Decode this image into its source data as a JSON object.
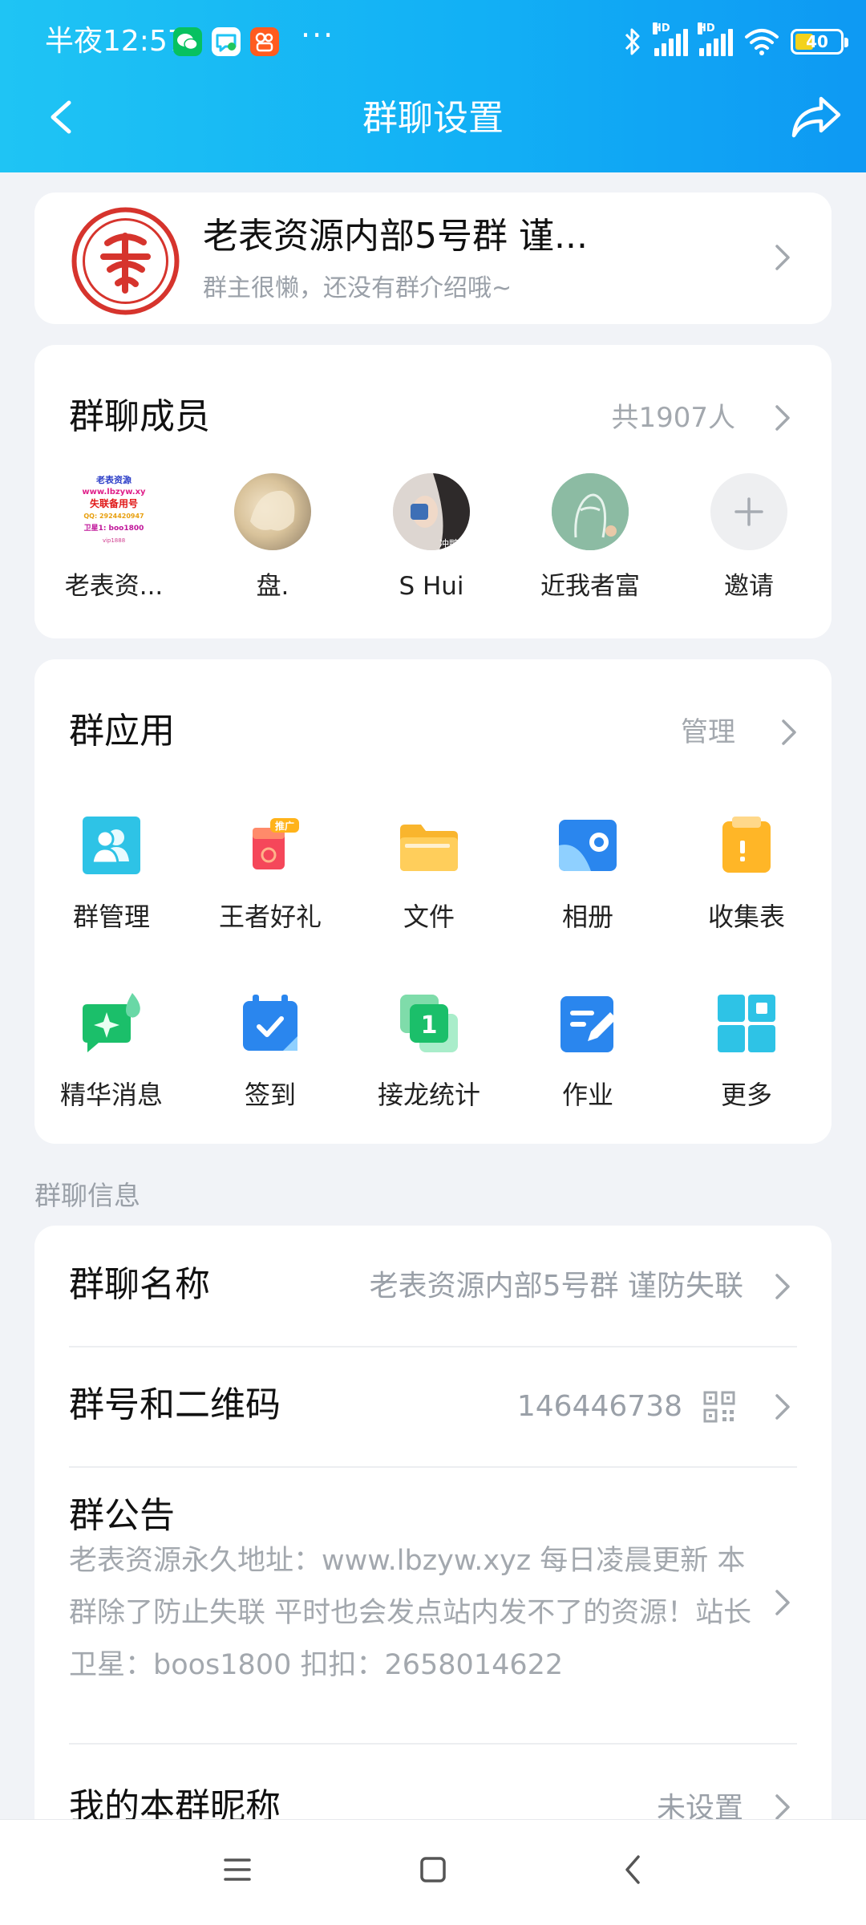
{
  "status_bar": {
    "time": "半夜12:57",
    "more": "···",
    "signal_1": "HD",
    "signal_2": "HD",
    "battery": "40"
  },
  "nav": {
    "title": "群聊设置"
  },
  "group": {
    "name": "老表资源内部5号群 谨...",
    "intro": "群主很懒，还没有群介绍哦~"
  },
  "members": {
    "title": "群聊成员",
    "count": "共1907人",
    "items": [
      {
        "name": "老表资..."
      },
      {
        "name": "盘."
      },
      {
        "name": "S    Hui"
      },
      {
        "name": "近我者富"
      },
      {
        "name": "邀请"
      }
    ],
    "avatar1_lines": [
      "老表资源",
      "www.lbzyw.xy",
      "失联备用号",
      "QQ: 2924420947",
      "卫星1: boo1800",
      "vip1888"
    ],
    "avatar3_text": "冲鸭"
  },
  "apps": {
    "title": "群应用",
    "manage": "管理",
    "items": [
      {
        "label": "群管理",
        "icon": "group-manage-icon"
      },
      {
        "label": "王者好礼",
        "icon": "game-gift-icon",
        "badge": "推广"
      },
      {
        "label": "文件",
        "icon": "folder-icon"
      },
      {
        "label": "相册",
        "icon": "album-icon"
      },
      {
        "label": "收集表",
        "icon": "clipboard-icon"
      },
      {
        "label": "精华消息",
        "icon": "essence-message-icon"
      },
      {
        "label": "签到",
        "icon": "calendar-check-icon"
      },
      {
        "label": "接龙统计",
        "icon": "relay-count-icon",
        "number": "1"
      },
      {
        "label": "作业",
        "icon": "homework-icon"
      },
      {
        "label": "更多",
        "icon": "more-grid-icon"
      }
    ]
  },
  "info": {
    "section_label": "群聊信息",
    "name_label": "群聊名称",
    "name_value": "老表资源内部5号群 谨防失联",
    "id_label": "群号和二维码",
    "id_value": "146446738",
    "notice_label": "群公告",
    "notice_text": "老表资源永久地址：www.lbzyw.xyz 每日凌晨更新 本群除了防止失联 平时也会发点站内发不了的资源！站长卫星：boos1800  扣扣：2658014622",
    "nickname_label": "我的本群昵称",
    "nickname_value": "未设置"
  },
  "colors": {
    "header_start": "#1fc4f4",
    "header_end": "#0e99f3",
    "page_bg": "#f1f3f7",
    "muted_text": "#9aa0a8"
  }
}
